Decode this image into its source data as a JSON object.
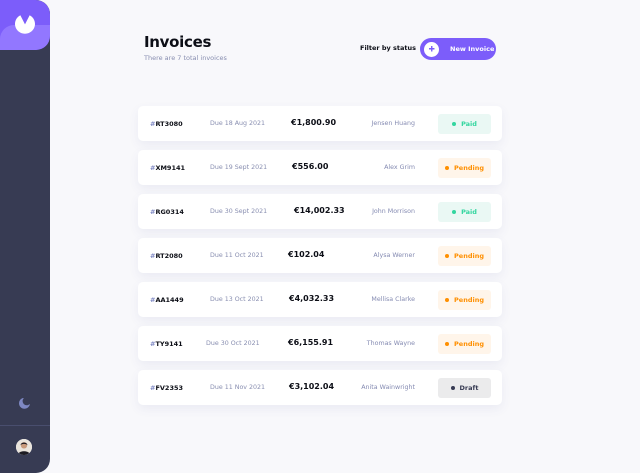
{
  "sidebar": {
    "logo_icon": "logo-icon",
    "theme_icon": "moon-icon",
    "avatar_icon": "avatar-icon",
    "colors": {
      "background": "#373b53",
      "logo": "#7c5dfa",
      "logo_lower": "#9277ff"
    }
  },
  "header": {
    "title": "Invoices",
    "subtitle": "There are 7 total invoices",
    "filter_label": "Filter by status",
    "new_button_label": "New Invoice",
    "accent": "#7c5dfa"
  },
  "invoices": [
    {
      "hash": "#",
      "id": "RT3080",
      "due": "Due 18 Aug 2021",
      "amount": "€1,800.90",
      "client": "Jensen Huang",
      "status": "Paid",
      "status_key": "paid"
    },
    {
      "hash": "#",
      "id": "XM9141",
      "due": "Due 19 Sept 2021",
      "amount": "€556.00",
      "client": "Alex Grim",
      "status": "Pending",
      "status_key": "pending"
    },
    {
      "hash": "#",
      "id": "RG0314",
      "due": "Due 30 Sept 2021",
      "amount": "€14,002.33",
      "client": "John Morrison",
      "status": "Paid",
      "status_key": "paid"
    },
    {
      "hash": "#",
      "id": "RT2080",
      "due": "Due 11 Oct 2021",
      "amount": "€102.04",
      "client": "Alysa Werner",
      "status": "Pending",
      "status_key": "pending"
    },
    {
      "hash": "#",
      "id": "AA1449",
      "due": "Due 13 Oct 2021",
      "amount": "€4,032.33",
      "client": "Mellisa Clarke",
      "status": "Pending",
      "status_key": "pending"
    },
    {
      "hash": "#",
      "id": "TY9141",
      "due": "Due 30 Oct 2021",
      "amount": "€6,155.91",
      "client": "Thomas Wayne",
      "status": "Pending",
      "status_key": "pending"
    },
    {
      "hash": "#",
      "id": "FV2353",
      "due": "Due 11 Nov 2021",
      "amount": "€3,102.04",
      "client": "Anita Wainwright",
      "status": "Draft",
      "status_key": "draft"
    }
  ],
  "status_colors": {
    "paid": "#33d69f",
    "pending": "#ff8f00",
    "draft": "#373b53"
  }
}
